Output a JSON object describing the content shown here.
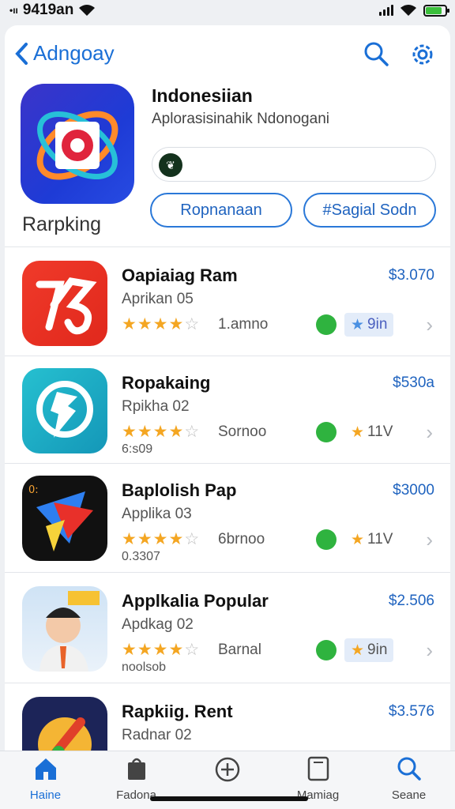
{
  "status_bar": {
    "time": "9419an"
  },
  "nav": {
    "back_label": "Adngoay"
  },
  "hero": {
    "icon_name": "Rarpking",
    "title": "Indonesiian",
    "subtitle": "Aplorasisinahik Ndonogani",
    "pill_left": "Ropnanaan",
    "pill_right": "#Sagial Sodn"
  },
  "apps": [
    {
      "name": "Oapiaiag Ram",
      "sub": "Aprikan 05",
      "reviews": "1.amno",
      "extra": "",
      "price": "$3.070",
      "badge": "9in",
      "badge_style": "blue",
      "stars": 4
    },
    {
      "name": "Ropakaing",
      "sub": "Rpikha 02",
      "reviews": "Sornoo",
      "extra": "6:s09",
      "price": "$530a",
      "badge": "11V",
      "badge_style": "plain",
      "stars": 4
    },
    {
      "name": "Baplolish Pap",
      "sub": "Applika 03",
      "reviews": "6brnoo",
      "extra": "0.3307",
      "price": "$3000",
      "badge": "11V",
      "badge_style": "plain",
      "stars": 4
    },
    {
      "name": "Applkalia Popular",
      "sub": "Apdkag 02",
      "reviews": "Barnal",
      "extra": "noolsob",
      "price": "$2.506",
      "badge": "9in",
      "badge_style": "gold",
      "stars": 4
    },
    {
      "name": "Rapkiig. Rent",
      "sub": "Radnar 02",
      "reviews": "",
      "extra": "",
      "price": "$3.576",
      "badge": "",
      "badge_style": "plain",
      "stars": 0
    }
  ],
  "tabs": [
    {
      "label": "Haine",
      "icon": "home-icon"
    },
    {
      "label": "Fadona",
      "icon": "bag-icon"
    },
    {
      "label": "",
      "icon": "plus-icon"
    },
    {
      "label": "Mamiag",
      "icon": "tablet-icon"
    },
    {
      "label": "Seane",
      "icon": "search-icon"
    }
  ],
  "colors": {
    "accent": "#1a6fd6",
    "star": "#f4a622",
    "status": "#2fb33f"
  }
}
